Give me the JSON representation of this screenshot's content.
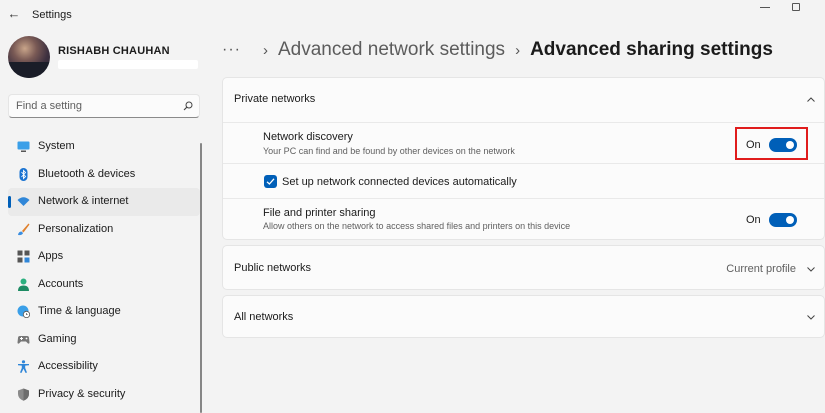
{
  "window": {
    "title": "Settings"
  },
  "profile": {
    "name": "RISHABH CHAUHAN"
  },
  "search": {
    "placeholder": "Find a setting"
  },
  "sidebar": {
    "items": [
      {
        "label": "System",
        "icon": "monitor-icon"
      },
      {
        "label": "Bluetooth & devices",
        "icon": "bluetooth-icon"
      },
      {
        "label": "Network & internet",
        "icon": "wifi-icon",
        "active": true
      },
      {
        "label": "Personalization",
        "icon": "brush-icon"
      },
      {
        "label": "Apps",
        "icon": "apps-icon"
      },
      {
        "label": "Accounts",
        "icon": "person-icon"
      },
      {
        "label": "Time & language",
        "icon": "globe-clock-icon"
      },
      {
        "label": "Gaming",
        "icon": "gamepad-icon"
      },
      {
        "label": "Accessibility",
        "icon": "accessibility-icon"
      },
      {
        "label": "Privacy & security",
        "icon": "shield-icon"
      }
    ]
  },
  "breadcrumb": {
    "more": "···",
    "parent": "Advanced network settings",
    "current": "Advanced sharing settings"
  },
  "private_networks": {
    "title": "Private networks",
    "network_discovery": {
      "title": "Network discovery",
      "description": "Your PC can find and be found by other devices on the network",
      "state": "On"
    },
    "auto_setup": {
      "label": "Set up network connected devices automatically",
      "checked": true
    },
    "file_printer_sharing": {
      "title": "File and printer sharing",
      "description": "Allow others on the network to access shared files and printers on this device",
      "state": "On"
    }
  },
  "public_networks": {
    "title": "Public networks",
    "status": "Current profile"
  },
  "all_networks": {
    "title": "All networks"
  },
  "colors": {
    "accent": "#005fb8",
    "highlight": "#e01c1c"
  }
}
